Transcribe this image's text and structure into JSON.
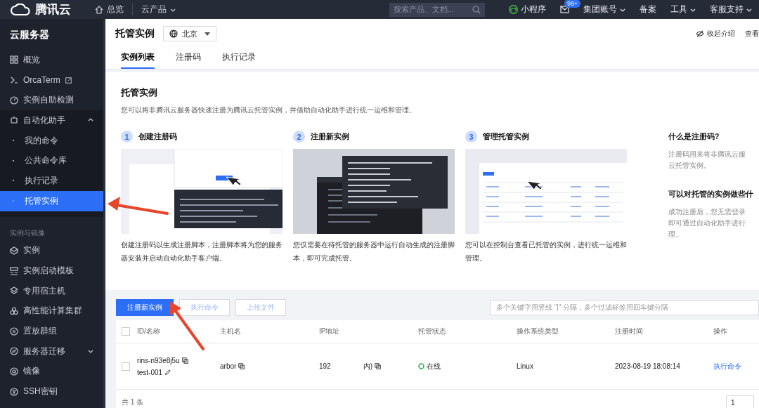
{
  "topbar": {
    "brand": "腾讯云",
    "nav": [
      {
        "label": "总览",
        "kind": "home"
      },
      {
        "label": "云产品",
        "kind": "dropdown"
      }
    ],
    "search": {
      "placeholder": "搜索产品、文档..."
    },
    "links": [
      {
        "label": "小程序",
        "kind": "mini"
      },
      {
        "kind": "mail",
        "badge": "99+"
      },
      {
        "label": "集团账号",
        "kind": "dropdown"
      },
      {
        "label": "备案",
        "kind": "plain"
      },
      {
        "label": "工具",
        "kind": "dropdown"
      },
      {
        "label": "客服支持",
        "kind": "dropdown"
      }
    ]
  },
  "sidebar": {
    "title": "云服务器",
    "items": [
      {
        "kind": "item",
        "label": "概览"
      },
      {
        "kind": "item",
        "label": "OrcaTerm",
        "external": true
      },
      {
        "kind": "item",
        "label": "实例自助检测"
      },
      {
        "kind": "group",
        "label": "自动化助手",
        "expanded": true,
        "children": [
          {
            "label": "我的命令",
            "selected": false
          },
          {
            "label": "公共命令库",
            "selected": false
          },
          {
            "label": "执行记录",
            "selected": false
          },
          {
            "label": "托管实例",
            "selected": true
          }
        ]
      },
      {
        "kind": "section",
        "label": "实例与镜像"
      },
      {
        "kind": "item",
        "label": "实例"
      },
      {
        "kind": "item",
        "label": "实例启动模板"
      },
      {
        "kind": "item",
        "label": "专用宿主机"
      },
      {
        "kind": "item",
        "label": "高性能计算集群"
      },
      {
        "kind": "item",
        "label": "置放群组"
      },
      {
        "kind": "group",
        "label": "服务器迁移",
        "expanded": false
      },
      {
        "kind": "item",
        "label": "镜像"
      },
      {
        "kind": "item",
        "label": "SSH密钥"
      }
    ]
  },
  "header": {
    "title": "托管实例",
    "region": "北京",
    "tabs": [
      {
        "label": "实例列表",
        "selected": true
      },
      {
        "label": "注册码",
        "selected": false
      },
      {
        "label": "执行记录",
        "selected": false
      }
    ],
    "collapse": "收起介绍",
    "more": "查看"
  },
  "intro": {
    "title": "托管实例",
    "description": "您可以将非腾讯云服务器快速注册为腾讯云托管实例，并借助自动化助手进行统一运维和管理。",
    "steps": [
      {
        "number": "1",
        "title": "创建注册码",
        "kind": "code",
        "description": "创建注册码以生成注册脚本，注册脚本将为您的服务器安装并启动自动化助手客户端。"
      },
      {
        "number": "2",
        "title": "注册新实例",
        "kind": "terminal",
        "description": "您仅需要在待托管的服务器中运行自动生成的注册脚本，即可完成托管。"
      },
      {
        "number": "3",
        "title": "管理托管实例",
        "kind": "table",
        "description": "您可以在控制台查看已托管的实例，进行统一运维和管理。"
      }
    ],
    "faq": [
      {
        "question": "什么是注册码?",
        "answer": [
          "注册码用来将非腾讯云服",
          "云托管实例。"
        ]
      },
      {
        "question": "可以对托管的实例做些什",
        "answer": [
          "成功注册后，您无需登录",
          "即可通过自动化助手进行",
          "理。"
        ]
      }
    ]
  },
  "toolbar": {
    "buttons": [
      {
        "label": "注册新实例",
        "kind": "primary",
        "disabled": false
      },
      {
        "label": "执行命令",
        "kind": "default",
        "disabled": true
      },
      {
        "label": "上传文件",
        "kind": "default",
        "disabled": true
      }
    ],
    "search": {
      "placeholder": "多个关键字用竖线 \"|\" 分隔，多个过滤标签用回车键分隔"
    }
  },
  "table": {
    "all_checked": false,
    "columns": [
      "ID/名称",
      "主机名",
      "IP地址",
      "托管状态",
      "操作系统类型",
      "注册时间",
      "操作"
    ],
    "rows": [
      {
        "checked": false,
        "id": "rins-n93e8j5u",
        "name": "test-001",
        "hostname": "arbor",
        "ip_start": "192",
        "ip_end": "内)",
        "status": "在线",
        "online": true,
        "os": "Linux",
        "registered": "2023-08-19 18:08:14",
        "action": "执行命令"
      }
    ],
    "total": "共 1 条",
    "page": "1"
  }
}
